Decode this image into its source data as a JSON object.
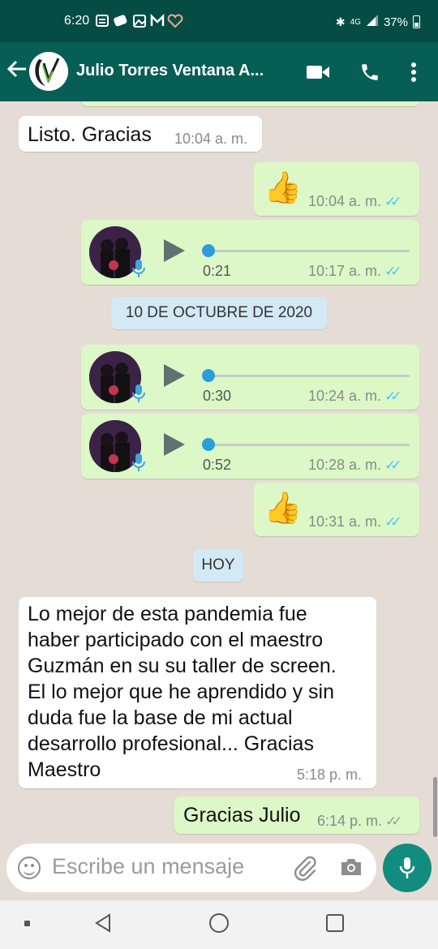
{
  "status_bar": {
    "time": "6:20",
    "battery": "37%",
    "network": "4G"
  },
  "header": {
    "back_icon": "arrow-left-icon",
    "contact_name": "Julio Torres Ventana A...",
    "video_icon": "video-call-icon",
    "call_icon": "phone-icon",
    "menu_icon": "more-vert-icon"
  },
  "messages": [
    {
      "type": "text",
      "direction": "in",
      "text": "Listo. Gracias",
      "time": "10:04 a. m."
    },
    {
      "type": "emoji",
      "direction": "out",
      "emoji": "👍",
      "time": "10:04 a. m.",
      "read": true
    },
    {
      "type": "voice",
      "direction": "out",
      "duration": "0:21",
      "time": "10:17 a. m.",
      "read": true,
      "progress": 0
    },
    {
      "type": "date",
      "text": "10 DE OCTUBRE DE 2020"
    },
    {
      "type": "voice",
      "direction": "out",
      "duration": "0:30",
      "time": "10:24 a. m.",
      "read": true,
      "progress": 0
    },
    {
      "type": "voice",
      "direction": "out",
      "duration": "0:52",
      "time": "10:28 a. m.",
      "read": true,
      "progress": 0
    },
    {
      "type": "emoji",
      "direction": "out",
      "emoji": "👍",
      "time": "10:31 a. m.",
      "read": true
    },
    {
      "type": "date",
      "text": "HOY"
    },
    {
      "type": "text",
      "direction": "in",
      "lines": [
        "Lo mejor de esta pandemia fue",
        "haber participado con el maestro",
        "Guzmán en su su taller de screen.",
        "El lo mejor que he aprendido y sin",
        "duda fue la base de mi actual",
        "desarrollo profesional... Gracias",
        "Maestro"
      ],
      "time": "5:18 p. m."
    },
    {
      "type": "text",
      "direction": "out",
      "text": "Gracias Julio",
      "time": "6:14 p. m.",
      "read": false
    }
  ],
  "composer": {
    "placeholder": "Escribe un mensaje",
    "emoji_icon": "emoji-icon",
    "attach_icon": "paperclip-icon",
    "camera_icon": "camera-icon",
    "mic_icon": "microphone-icon"
  },
  "colors": {
    "header": "#075e54",
    "status_bar": "#054d44",
    "outgoing_bubble": "#dcf8c6",
    "incoming_bubble": "#ffffff",
    "background": "#e5ddd5",
    "read_ticks": "#4fc3f7",
    "accent": "#128c7e"
  }
}
